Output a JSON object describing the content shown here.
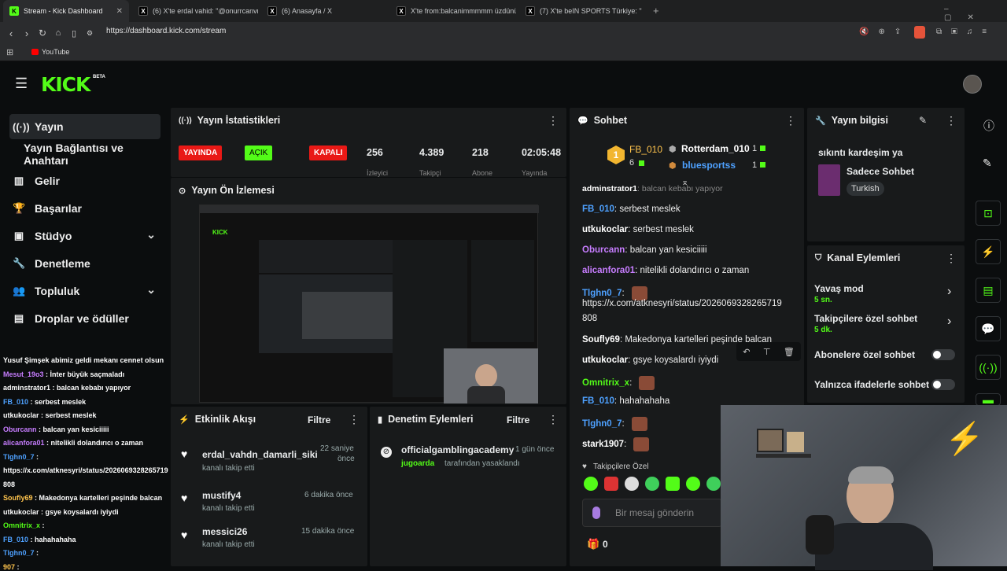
{
  "browser": {
    "tabs": [
      {
        "title": "Stream - Kick Dashboard",
        "fav": "K"
      },
      {
        "title": "(6) X'te erdal vahid: \"@onurrcanvm",
        "fav": "X"
      },
      {
        "title": "(6) Anasayfa / X",
        "fav": "X"
      },
      {
        "title": "X'te from:balcanimmmmm üzdünüz",
        "fav": "X"
      },
      {
        "title": "(7) X'te beIN SPORTS Türkiye: \"",
        "fav": "X"
      }
    ],
    "url": "https://dashboard.kick.com/stream",
    "bookmark": "YouTube"
  },
  "kick": {
    "logo": "KICK",
    "beta": "BETA"
  },
  "sidebar": {
    "items": [
      {
        "label": "Yayın",
        "icon": "broadcast-icon"
      },
      {
        "label": "Yayın Bağlantısı ve Anahtarı"
      },
      {
        "label": "Gelir",
        "icon": "chart-icon"
      },
      {
        "label": "Başarılar",
        "icon": "trophy-icon"
      },
      {
        "label": "Stüdyo",
        "icon": "studio-icon"
      },
      {
        "label": "Denetleme",
        "icon": "wrench-icon"
      },
      {
        "label": "Topluluk",
        "icon": "people-icon"
      },
      {
        "label": "Droplar ve ödüller",
        "icon": "drops-icon"
      }
    ]
  },
  "stats": {
    "title": "Yayın İstatistikleri",
    "live": "YAYINDA",
    "on": "AÇIK",
    "off": "KAPALI",
    "v1": "256",
    "l1": "İzleyici",
    "v2": "4.389",
    "l2": "Takipçi",
    "v3": "218",
    "l3": "Abone",
    "v4": "02:05:48",
    "l4": "Yayında"
  },
  "preview": {
    "title": "Yayın Ön İzlemesi"
  },
  "chat_overlay": [
    {
      "user": "",
      "msg": "Yusuf Şimşek abimiz geldi mekanı cennet olsun",
      "color": "#ffffff"
    },
    {
      "user": "Mesut_19o3",
      "msg": "İnter büyük saçmaladı",
      "color": "#c77dff"
    },
    {
      "user": "adminstrator1",
      "msg": "balcan kebabı yapıyor",
      "color": "#ffffff"
    },
    {
      "user": "FB_010",
      "msg": "serbest meslek",
      "color": "#4ea1ff"
    },
    {
      "user": "utkukoclar",
      "msg": "serbest meslek",
      "color": "#ffffff"
    },
    {
      "user": "Oburcann",
      "msg": "balcan yan kesiciiiii",
      "color": "#c77dff"
    },
    {
      "user": "alicanfora01",
      "msg": "nitelikli dolandırıcı o zaman",
      "color": "#c77dff"
    },
    {
      "user": "Tlghn0_7",
      "msg": "",
      "color": "#4ea1ff"
    },
    {
      "user": "",
      "msg": "https://x.com/atknesyri/status/2026069328265719",
      "color": "#ffffff"
    },
    {
      "user": "",
      "msg": "808",
      "color": "#ffffff"
    },
    {
      "user": "Soufly69",
      "msg": "Makedonya kartelleri peşinde balcan",
      "color": "#ffc44d"
    },
    {
      "user": "utkukoclar",
      "msg": "gsye koysalardı iyiydi",
      "color": "#ffffff"
    },
    {
      "user": "Omnitrix_x",
      "msg": "",
      "color": "#53fc18"
    },
    {
      "user": "FB_010",
      "msg": "hahahahaha",
      "color": "#4ea1ff"
    },
    {
      "user": "Tlghn0_7",
      "msg": "",
      "color": "#4ea1ff"
    },
    {
      "user": "907",
      "msg": "",
      "color": "#ffc44d"
    }
  ],
  "activity": {
    "title": "Etkinlik Akışı",
    "filter": "Filtre",
    "items": [
      {
        "name": "erdal_vahdn_damarli_siki",
        "action": "kanalı takip etti",
        "time": "22 saniye",
        "time2": "önce"
      },
      {
        "name": "mustify4",
        "action": "kanalı takip etti",
        "time": "6 dakika önce",
        "time2": ""
      },
      {
        "name": "messici26",
        "action": "kanalı takip etti",
        "time": "15 dakika önce",
        "time2": ""
      }
    ]
  },
  "moderation": {
    "title": "Denetim Eylemleri",
    "filter": "Filtre",
    "user": "officialgamblingacademy",
    "time": "1 gün önce",
    "by": "jugoarda",
    "action": "tarafından yasaklandı"
  },
  "chat": {
    "title": "Sohbet",
    "lead_name": "FB_010",
    "lead_count": "6",
    "r2": "Rotterdam_010",
    "r2c": "1",
    "r3": "bluesportss",
    "r3c": "1",
    "msgs": [
      {
        "user": "adminstrator1",
        "msg": "balcan kebabı yapıyor",
        "color": "#ffffff"
      },
      {
        "user": "FB_010",
        "msg": "serbest meslek",
        "color": "#4ea1ff"
      },
      {
        "user": "utkukoclar",
        "msg": "serbest meslek",
        "color": "#ffffff"
      },
      {
        "user": "Oburcann",
        "msg": "balcan yan kesiciiiii",
        "color": "#c77dff"
      },
      {
        "user": "alicanfora01",
        "msg": "nitelikli dolandırıcı o zaman",
        "color": "#c77dff"
      },
      {
        "user": "Tlghn0_7",
        "msg": "",
        "color": "#4ea1ff"
      },
      {
        "user": "",
        "msg": "https://x.com/atknesyri/status/2026069328265719",
        "color": "#ffffff"
      },
      {
        "user": "",
        "msg": "808",
        "color": "#ffffff"
      },
      {
        "user": "Soufly69",
        "msg": "Makedonya kartelleri peşinde balcan",
        "color": "#ffffff"
      },
      {
        "user": "utkukoclar",
        "msg": "gsye koysalardı iyiydi",
        "color": "#ffffff"
      },
      {
        "user": "Omnitrix_x",
        "msg": "",
        "color": "#53fc18"
      },
      {
        "user": "FB_010",
        "msg": "hahahahaha",
        "color": "#4ea1ff"
      },
      {
        "user": "Tlghn0_7",
        "msg": "",
        "color": "#4ea1ff"
      },
      {
        "user": "stark1907",
        "msg": "",
        "color": "#ffffff"
      }
    ],
    "followers_only": "Takipçilere Özel",
    "placeholder": "Bir mesaj gönderin",
    "gift_count": "0"
  },
  "info": {
    "title": "Yayın bilgisi",
    "stream_title": "sıkıntı kardeşim ya",
    "category": "Sadece Sohbet",
    "language": "Turkish"
  },
  "actions": {
    "title": "Kanal Eylemleri",
    "slow": "Yavaş mod",
    "slow_val": "5 sn.",
    "followers": "Takipçilere özel sohbet",
    "followers_val": "5 dk.",
    "subs": "Abonelere özel sohbet",
    "emotes": "Yalnızca ifadelerle sohbet"
  },
  "colors": {
    "accent": "#53fc18",
    "live": "#e91916"
  }
}
